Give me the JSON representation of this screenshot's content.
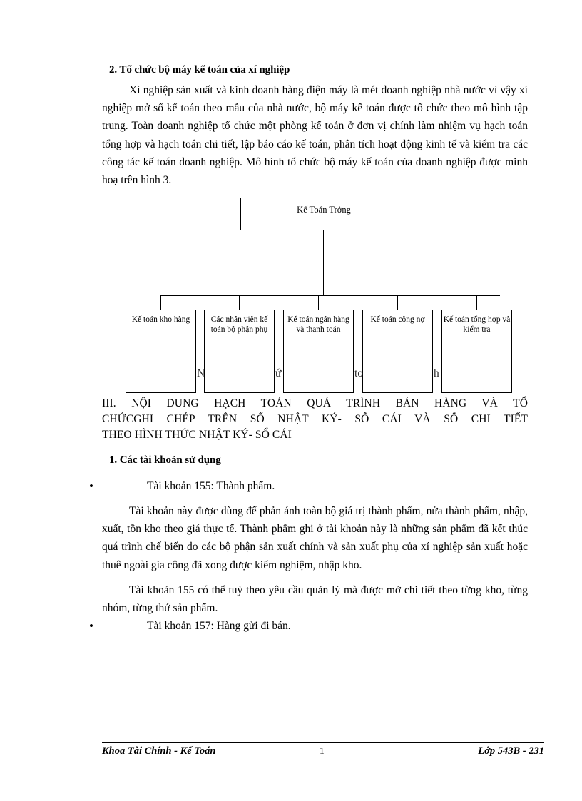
{
  "document": {
    "language": "vi",
    "section_heading": "2. Tổ chức bộ máy kế toán của xí nghiệp",
    "intro_paragraph": "Xí nghiệp sản xuất và kinh doanh hàng điện máy là mét doanh nghiệp nhà nước vì vậy xí nghiệp mở sổ kế toán theo mẫu của nhà nước, bộ máy kế toán được tổ chức theo mô hình tập trung. Toàn doanh nghiệp tổ chức một phòng kế toán ở đơn vị chính làm nhiệm vụ hạch toán tổng hợp và hạch toán chi tiết, lập báo cáo kế toán, phân tích hoạt động kinh tế và kiểm tra các công tác kế toán doanh nghiệp. Mô hình tổ chức bộ máy kế toán của doanh nghiệp được minh hoạ trên hình 3."
  },
  "org_chart": {
    "root": {
      "label": "Kế Toán Trởng"
    },
    "leaves": [
      {
        "label": "Kế toán kho hàng"
      },
      {
        "label": "Các nhân viên kế toán bộ phận phụ"
      },
      {
        "label": "Kế toán ngân hàng và thanh toán"
      },
      {
        "label": "Kế toán công nợ"
      },
      {
        "label": "Kế toán tổng hợp và kiểm tra"
      }
    ],
    "occluded_fragments": [
      "N",
      "ứ",
      "to",
      "h r"
    ]
  },
  "roman_heading": {
    "line1": "III.  NỘI  DUNG  HẠCH  TOÁN  QUÁ  TRÌNH  BÁN  HÀNG  VÀ  TỔ",
    "line2": "CHỨCGHI  CHÉP  TRÊN  SỔ  NHẬT  KÝ-  SỔ  CÁI  VÀ  SỔ  CHI  TIẾT",
    "line3": "THEO HÌNH THỨC NHẬT KÝ- SỔ CÁI"
  },
  "accounts_section": {
    "heading": "1. Các tài khoản sử dụng",
    "bullet_marker": "•",
    "items": [
      {
        "bullet": "Tài khoản 155: Thành phẩm.",
        "paragraphs": [
          "Tài khoản này được dùng để phản ánh toàn bộ giá trị thành phẩm, nửa thành phẩm, nhập, xuất, tồn kho theo giá thực tế. Thành phẩm ghi ở tài khoản này là những sản phẩm đã kết thúc quá trình chế biến do các bộ phận sản xuất chính và sản xuất phụ của xí nghiệp sản xuất hoặc thuê ngoài gia công đã xong được kiểm nghiệm, nhập kho.",
          "Tài khoản 155 có thể tuỳ theo yêu cầu quản lý mà được mở chi tiết theo từng kho, từng nhóm, từng thứ sản phẩm."
        ]
      },
      {
        "bullet": "Tài khoản 157: Hàng gửi đi bán.",
        "paragraphs": []
      }
    ]
  },
  "footer": {
    "left": "Khoa Tài Chính - Kế Toán",
    "page_number": "1",
    "right": "Lớp 543B - 231"
  }
}
